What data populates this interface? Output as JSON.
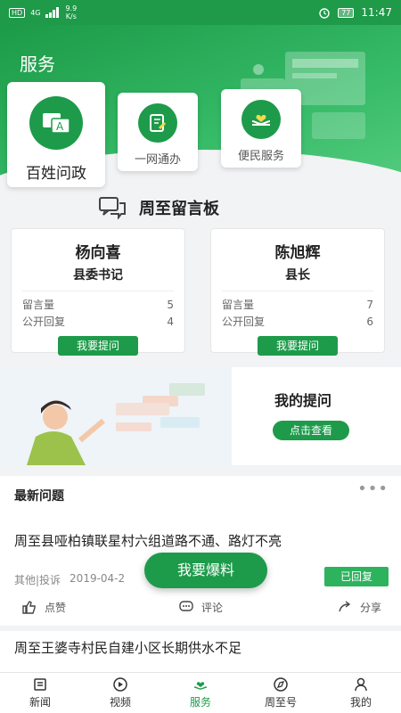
{
  "status": {
    "hd": "HD",
    "signal": "4G",
    "speed": "9.9",
    "speed_unit": "K/s",
    "battery": "77",
    "time": "11:47"
  },
  "header": {
    "title": "服务"
  },
  "services": [
    {
      "label": "百姓问政",
      "icon": "chat-A-icon"
    },
    {
      "label": "一网通办",
      "icon": "document-pen-icon"
    },
    {
      "label": "便民服务",
      "icon": "heart-hands-icon"
    }
  ],
  "board": {
    "title": "周至留言板",
    "icon": "chat-bubbles-icon"
  },
  "leaders": [
    {
      "name": "杨向喜",
      "role": "县委书记",
      "msg_label": "留言量",
      "msg_count": "5",
      "reply_label": "公开回复",
      "reply_count": "4",
      "ask_label": "我要提问"
    },
    {
      "name": "陈旭辉",
      "role": "县长",
      "msg_label": "留言量",
      "msg_count": "7",
      "reply_label": "公开回复",
      "reply_count": "6",
      "ask_label": "我要提问"
    }
  ],
  "my_questions": {
    "title": "我的提问",
    "button": "点击查看"
  },
  "latest": {
    "title": "最新问题",
    "more": "•••",
    "items": [
      {
        "title": "周至县哑柏镇联星村六组道路不通、路灯不亮",
        "category": "其他|投诉",
        "date": "2019-04-2",
        "status": "已回复",
        "like": "点赞",
        "comment": "评论",
        "share": "分享"
      },
      {
        "title": "周至王婆寺村民自建小区长期供水不足"
      }
    ]
  },
  "fab": {
    "label": "我要爆料"
  },
  "tabs": [
    {
      "label": "新闻",
      "icon": "news-icon"
    },
    {
      "label": "视频",
      "icon": "video-icon"
    },
    {
      "label": "服务",
      "icon": "service-heart-icon",
      "active": true
    },
    {
      "label": "周至号",
      "icon": "compass-icon"
    },
    {
      "label": "我的",
      "icon": "profile-icon"
    }
  ],
  "colors": {
    "primary": "#1d9b4a",
    "accent_light": "#2db35e"
  }
}
